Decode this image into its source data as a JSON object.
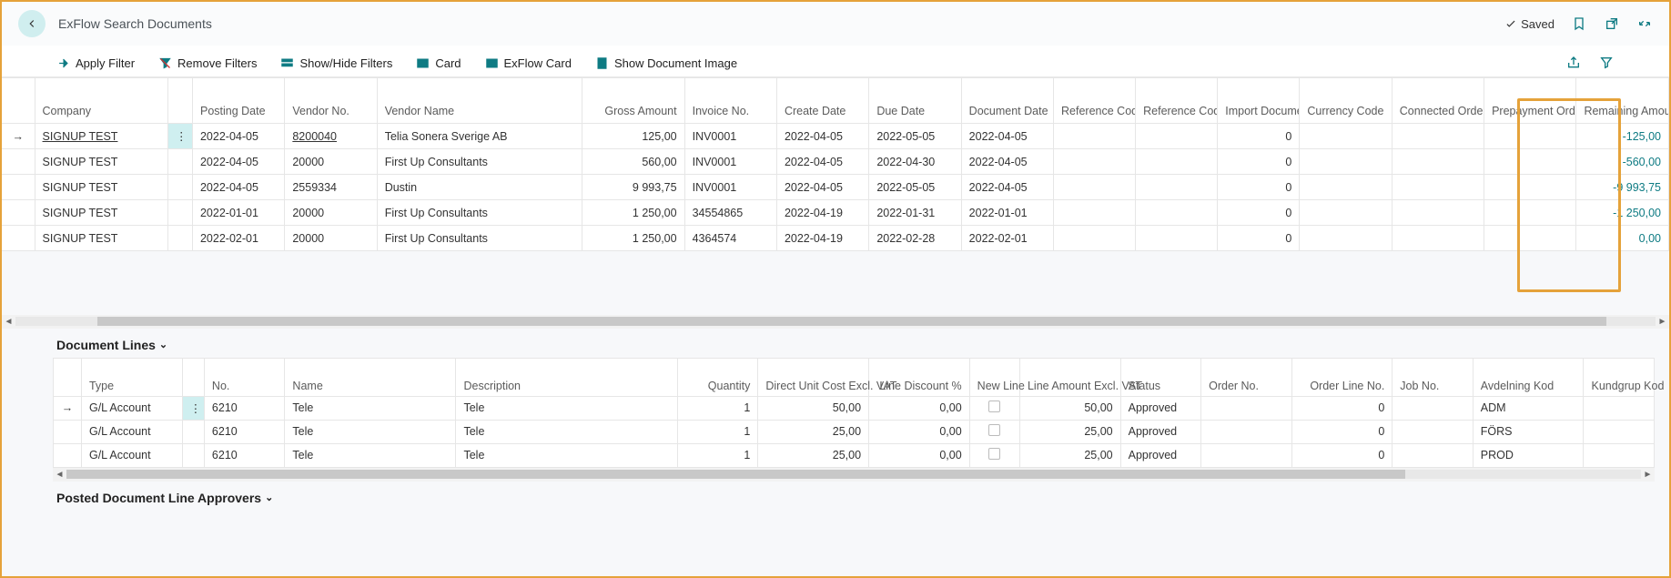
{
  "header": {
    "title": "ExFlow Search Documents",
    "saved_label": "Saved"
  },
  "toolbar": {
    "apply": "Apply Filter",
    "remove": "Remove Filters",
    "showhide": "Show/Hide Filters",
    "card": "Card",
    "exflowcard": "ExFlow Card",
    "showimage": "Show Document Image"
  },
  "columns_main": {
    "company": "Company",
    "posting_date": "Posting Date",
    "vendor_no": "Vendor No.",
    "vendor_name": "Vendor Name",
    "gross_amount": "Gross Amount",
    "invoice_no": "Invoice No.",
    "create_date": "Create Date",
    "due_date": "Due Date",
    "document_date": "Document Date",
    "reference_code": "Reference Code",
    "reference_code_import": "Reference Code (Import)",
    "import_doc_no": "Import Document No.",
    "currency_code": "Currency Code",
    "connected_order": "Connected Order No. (first)",
    "prepayment": "Prepayment Order No.",
    "remaining": "Remaining Amount"
  },
  "rows_main": [
    {
      "company": "SIGNUP TEST",
      "posting": "2022-04-05",
      "vendor_no": "8200040",
      "vendor": "Telia Sonera Sverige AB",
      "gross": "125,00",
      "inv": "INV0001",
      "create": "2022-04-05",
      "due": "2022-05-05",
      "doc": "2022-04-05",
      "import": "0",
      "remain": "-125,00",
      "sel": true
    },
    {
      "company": "SIGNUP TEST",
      "posting": "2022-04-05",
      "vendor_no": "20000",
      "vendor": "First Up Consultants",
      "gross": "560,00",
      "inv": "INV0001",
      "create": "2022-04-05",
      "due": "2022-04-30",
      "doc": "2022-04-05",
      "import": "0",
      "remain": "-560,00"
    },
    {
      "company": "SIGNUP TEST",
      "posting": "2022-04-05",
      "vendor_no": "2559334",
      "vendor": "Dustin",
      "gross": "9 993,75",
      "inv": "INV0001",
      "create": "2022-04-05",
      "due": "2022-05-05",
      "doc": "2022-04-05",
      "import": "0",
      "remain": "-9 993,75"
    },
    {
      "company": "SIGNUP TEST",
      "posting": "2022-01-01",
      "vendor_no": "20000",
      "vendor": "First Up Consultants",
      "gross": "1 250,00",
      "inv": "34554865",
      "create": "2022-04-19",
      "due": "2022-01-31",
      "doc": "2022-01-01",
      "import": "0",
      "remain": "-1 250,00"
    },
    {
      "company": "SIGNUP TEST",
      "posting": "2022-02-01",
      "vendor_no": "20000",
      "vendor": "First Up Consultants",
      "gross": "1 250,00",
      "inv": "4364574",
      "create": "2022-04-19",
      "due": "2022-02-28",
      "doc": "2022-02-01",
      "import": "0",
      "remain": "0,00"
    }
  ],
  "section_lines_title": "Document Lines",
  "columns_lines": {
    "type": "Type",
    "no": "No.",
    "name": "Name",
    "description": "Description",
    "quantity": "Quantity",
    "unit_cost": "Direct Unit Cost Excl. VAT",
    "discount": "Line Discount %",
    "new_line": "New Line",
    "line_amount": "Line Amount Excl. VAT",
    "status": "Status",
    "order_no": "Order No.",
    "order_line_no": "Order Line No.",
    "job_no": "Job No.",
    "avdelning": "Avdelning Kod",
    "kundgrup": "Kundgrup Kod"
  },
  "rows_lines": [
    {
      "type": "G/L Account",
      "no": "6210",
      "name": "Tele",
      "desc": "Tele",
      "qty": "1",
      "unit": "50,00",
      "disc": "0,00",
      "amount": "50,00",
      "status": "Approved",
      "orderline": "0",
      "avd": "ADM",
      "sel": true
    },
    {
      "type": "G/L Account",
      "no": "6210",
      "name": "Tele",
      "desc": "Tele",
      "qty": "1",
      "unit": "25,00",
      "disc": "0,00",
      "amount": "25,00",
      "status": "Approved",
      "orderline": "0",
      "avd": "FÖRS"
    },
    {
      "type": "G/L Account",
      "no": "6210",
      "name": "Tele",
      "desc": "Tele",
      "qty": "1",
      "unit": "25,00",
      "disc": "0,00",
      "amount": "25,00",
      "status": "Approved",
      "orderline": "0",
      "avd": "PROD"
    }
  ],
  "section_approvers_title": "Posted Document Line Approvers"
}
